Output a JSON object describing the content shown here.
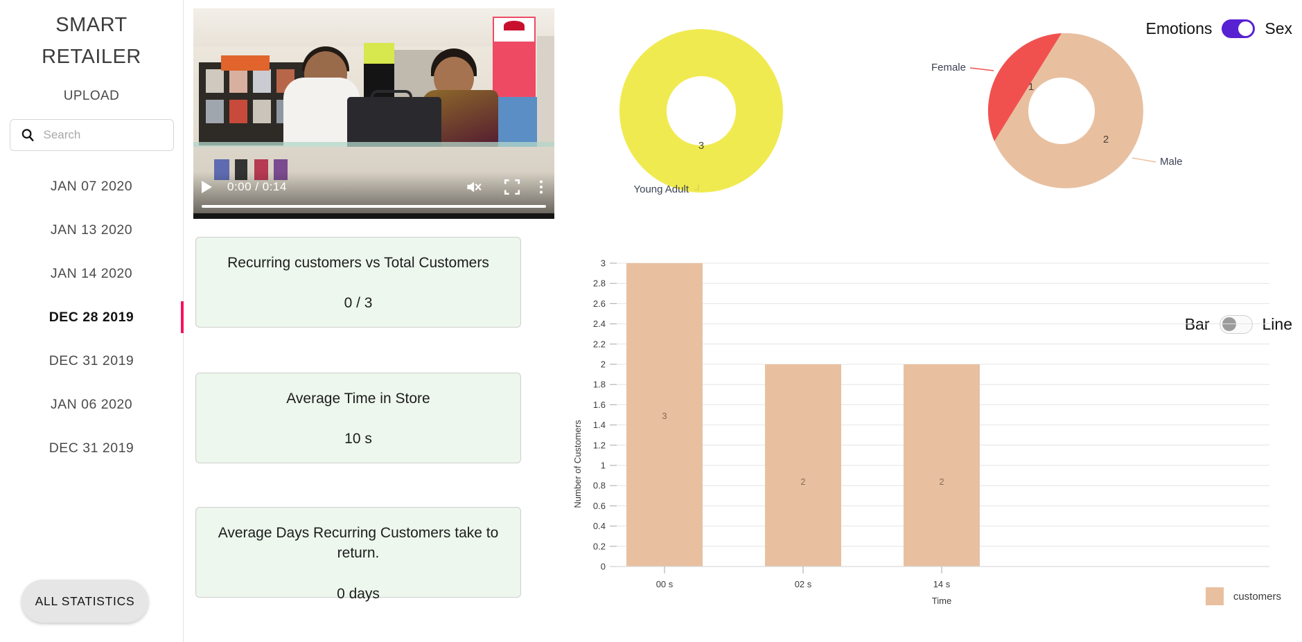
{
  "sidebar": {
    "brand_line1": "SMART",
    "brand_line2": "RETAILER",
    "upload_label": "UPLOAD",
    "search": {
      "placeholder": "Search",
      "value": "",
      "icon": "search-icon"
    },
    "dates": [
      {
        "label": "JAN 07 2020",
        "active": false
      },
      {
        "label": "JAN 13 2020",
        "active": false
      },
      {
        "label": "JAN 14 2020",
        "active": false
      },
      {
        "label": "DEC 28 2019",
        "active": true
      },
      {
        "label": "DEC 31 2019",
        "active": false
      },
      {
        "label": "JAN 06 2020",
        "active": false
      },
      {
        "label": "DEC 31 2019",
        "active": false
      }
    ],
    "active_marker_color": "#f5115e",
    "all_statistics_label": "ALL STATISTICS"
  },
  "video": {
    "time_display": "0:00 / 0:14",
    "current_time": "0:00",
    "duration": "0:14",
    "play_icon": "play-icon",
    "mute_icon": "mute-icon",
    "fullscreen_icon": "fullscreen-icon",
    "more_icon": "more-options-icon",
    "progress_percent": 0
  },
  "cards": [
    {
      "title": "Recurring customers vs Total Customers",
      "value": "0 / 3"
    },
    {
      "title": "Average Time in Store",
      "value": "10 s"
    },
    {
      "title": "Average Days Recurring Customers take to return.",
      "value": "0 days"
    }
  ],
  "toggles": {
    "emotions_label": "Emotions",
    "sex_label": "Sex",
    "emotions_sex_state": "sex",
    "bar_label": "Bar",
    "line_label": "Line",
    "bar_line_state": "bar",
    "on_color": "#5821d2",
    "off_color": "#9b9b9b"
  },
  "chart_data": [
    {
      "type": "pie",
      "name": "age-donut",
      "title": "",
      "labels": [
        "Young Adult"
      ],
      "values": [
        3
      ],
      "colors": [
        "#f0ea51"
      ],
      "hole": 0.42,
      "legend_position": "none",
      "annotations": [
        "3"
      ]
    },
    {
      "type": "pie",
      "name": "sex-donut",
      "title": "",
      "labels": [
        "Male",
        "Female"
      ],
      "values": [
        2,
        1
      ],
      "colors": [
        "#e8c0a0",
        "#f0514f"
      ],
      "hole": 0.42,
      "legend_position": "none",
      "annotations": [
        "2",
        "1"
      ]
    },
    {
      "type": "bar",
      "name": "customers-over-time",
      "categories": [
        "00 s",
        "02 s",
        "14 s"
      ],
      "values": [
        3,
        2,
        2
      ],
      "series": [
        {
          "name": "customers",
          "values": [
            3,
            2,
            2
          ]
        }
      ],
      "title": "",
      "xlabel": "Time",
      "ylabel": "Number of Customers",
      "ylim": [
        0,
        3
      ],
      "ytick_labels": [
        "0",
        "0.2",
        "0.4",
        "0.6",
        "0.8",
        "1",
        "1.2",
        "1.4",
        "1.6",
        "1.8",
        "2",
        "2.2",
        "2.4",
        "2.6",
        "2.8",
        "3"
      ],
      "grid": true,
      "legend_position": "right-bottom",
      "legend_entries": [
        "customers"
      ],
      "bar_color": "#e8c0a0"
    }
  ]
}
